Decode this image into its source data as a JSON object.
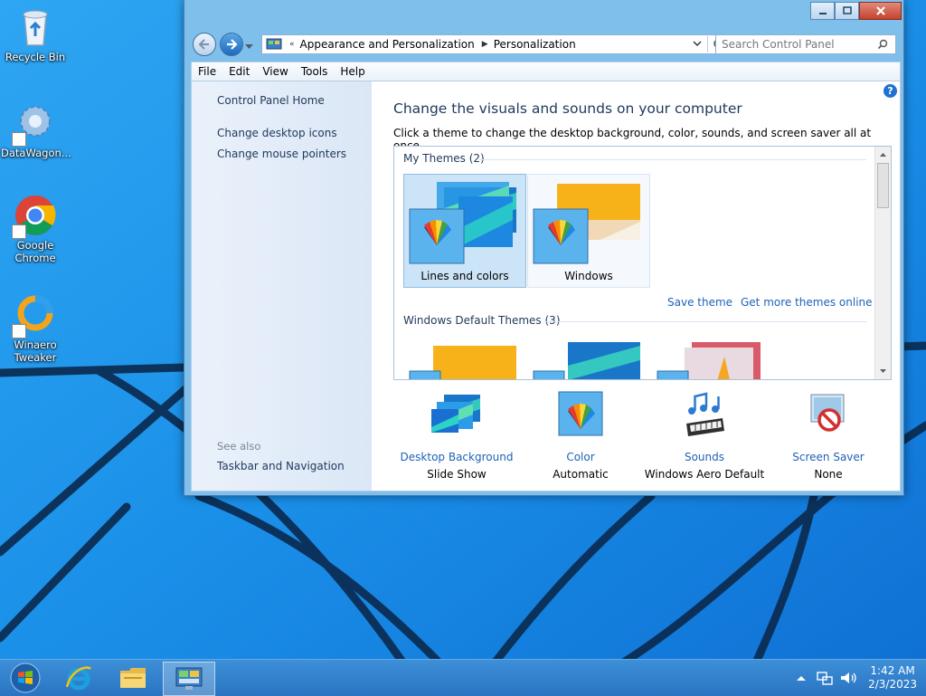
{
  "desktop": {
    "icons": [
      {
        "label": "Recycle Bin"
      },
      {
        "label": "DataWagon..."
      },
      {
        "label": "Google Chrome"
      },
      {
        "label": "Winaero Tweaker"
      }
    ]
  },
  "window": {
    "address": {
      "crumbs": [
        "Appearance and Personalization",
        "Personalization"
      ]
    },
    "search": {
      "placeholder": "Search Control Panel"
    },
    "menu": [
      "File",
      "Edit",
      "View",
      "Tools",
      "Help"
    ],
    "left_pane": {
      "home": "Control Panel Home",
      "links": [
        "Change desktop icons",
        "Change mouse pointers"
      ],
      "see_also_header": "See also",
      "see_also_links": [
        "Taskbar and Navigation"
      ]
    },
    "main": {
      "title": "Change the visuals and sounds on your computer",
      "subtitle": "Click a theme to change the desktop background, color, sounds, and screen saver all at once.",
      "my_themes_header": "My Themes (2)",
      "my_themes": [
        {
          "name": "Lines and colors",
          "selected": true
        },
        {
          "name": "Windows",
          "selected": false
        }
      ],
      "save_theme": "Save theme",
      "get_more": "Get more themes online",
      "default_themes_header": "Windows Default Themes (3)",
      "bottom": [
        {
          "link": "Desktop Background",
          "value": "Slide Show"
        },
        {
          "link": "Color",
          "value": "Automatic"
        },
        {
          "link": "Sounds",
          "value": "Windows Aero Default"
        },
        {
          "link": "Screen Saver",
          "value": "None"
        }
      ]
    }
  },
  "taskbar": {
    "time": "1:42 AM",
    "date": "2/3/2023"
  },
  "colors": {
    "link": "#1e62b8",
    "heading": "#1e395b",
    "desktop": "#1c8ee6",
    "selected_tile": "#cce4f7"
  }
}
